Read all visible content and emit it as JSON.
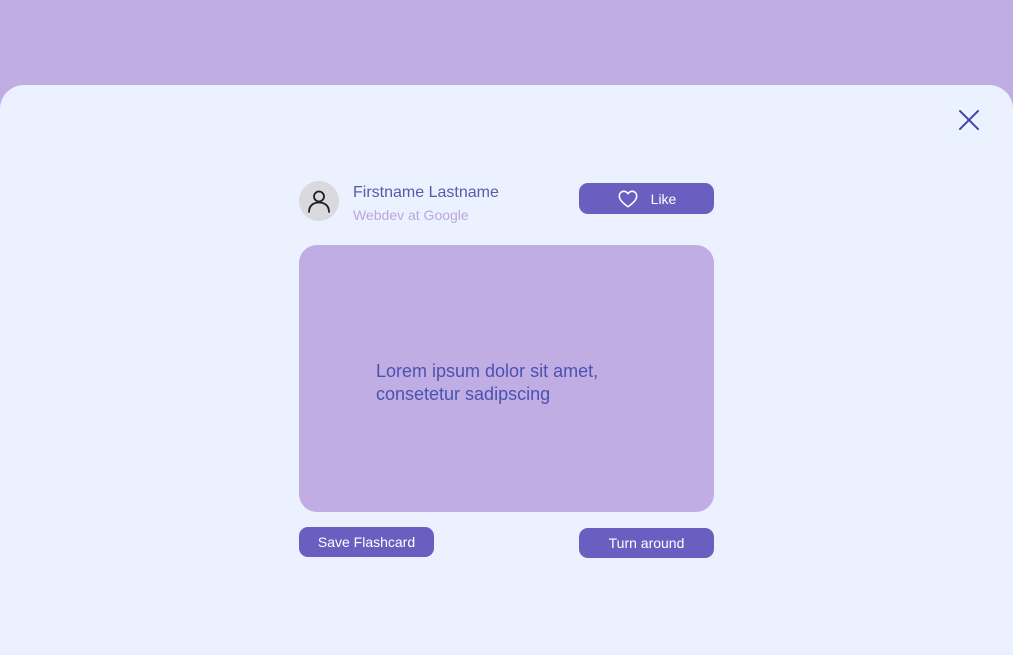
{
  "profile": {
    "name": "Firstname Lastname",
    "role": "Webdev at Google",
    "avatar_icon": "user-icon"
  },
  "actions": {
    "like_label": "Like",
    "like_icon": "heart-icon",
    "save_label": "Save Flashcard",
    "turn_label": "Turn around",
    "close_icon": "close-icon"
  },
  "flashcard": {
    "text": "Lorem ipsum dolor sit amet, consetetur sadipscing"
  },
  "colors": {
    "backdrop": "#c0ade4",
    "sheet": "#ecf1ff",
    "card": "#c0ade4",
    "button": "#6a5fc1",
    "accent_text": "#4a52b0"
  }
}
